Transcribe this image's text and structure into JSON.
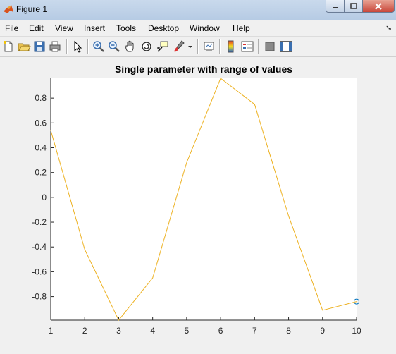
{
  "window": {
    "title": "Figure 1"
  },
  "menu": [
    {
      "label": "File",
      "name": "menu-file"
    },
    {
      "label": "Edit",
      "name": "menu-edit"
    },
    {
      "label": "View",
      "name": "menu-view"
    },
    {
      "label": "Insert",
      "name": "menu-insert"
    },
    {
      "label": "Tools",
      "name": "menu-tools"
    },
    {
      "label": "Desktop",
      "name": "menu-desktop"
    },
    {
      "label": "Window",
      "name": "menu-window"
    },
    {
      "label": "Help",
      "name": "menu-help"
    }
  ],
  "toolbar": [
    "new-figure-icon",
    "open-file-icon",
    "save-icon",
    "print-icon",
    "edit-plot-icon",
    "zoom-in-icon",
    "zoom-out-icon",
    "pan-icon",
    "rotate-3d-icon",
    "data-cursor-icon",
    "brush-icon",
    "link-plot-icon",
    "colorbar-icon",
    "legend-icon",
    "hide-plot-tools-icon",
    "show-plot-tools-icon"
  ],
  "chart_data": {
    "type": "line",
    "title": "Single parameter  with range of values",
    "xlabel": "",
    "ylabel": "",
    "x": [
      1,
      2,
      3,
      4,
      5,
      6,
      7,
      8,
      9,
      10
    ],
    "series": [
      {
        "values": [
          0.54,
          -0.42,
          -0.99,
          -0.65,
          0.28,
          0.96,
          0.75,
          -0.15,
          -0.91,
          -0.84
        ],
        "color": "#edb120"
      }
    ],
    "marker": {
      "x": 10,
      "y": -0.84,
      "style": "circle",
      "color": "#0072bd"
    },
    "xlim": [
      1,
      10
    ],
    "ylim": [
      -0.99,
      0.96
    ],
    "xticks": [
      1,
      2,
      3,
      4,
      5,
      6,
      7,
      8,
      9,
      10
    ],
    "yticks": [
      -0.8,
      -0.6,
      -0.4,
      -0.2,
      0,
      0.2,
      0.4,
      0.6,
      0.8
    ],
    "ytick_labels": [
      "-0.8",
      "-0.6",
      "-0.4",
      "-0.2",
      "0",
      "0.2",
      "0.4",
      "0.6",
      "0.8"
    ],
    "grid": false,
    "axes_background": "#ffffff"
  }
}
